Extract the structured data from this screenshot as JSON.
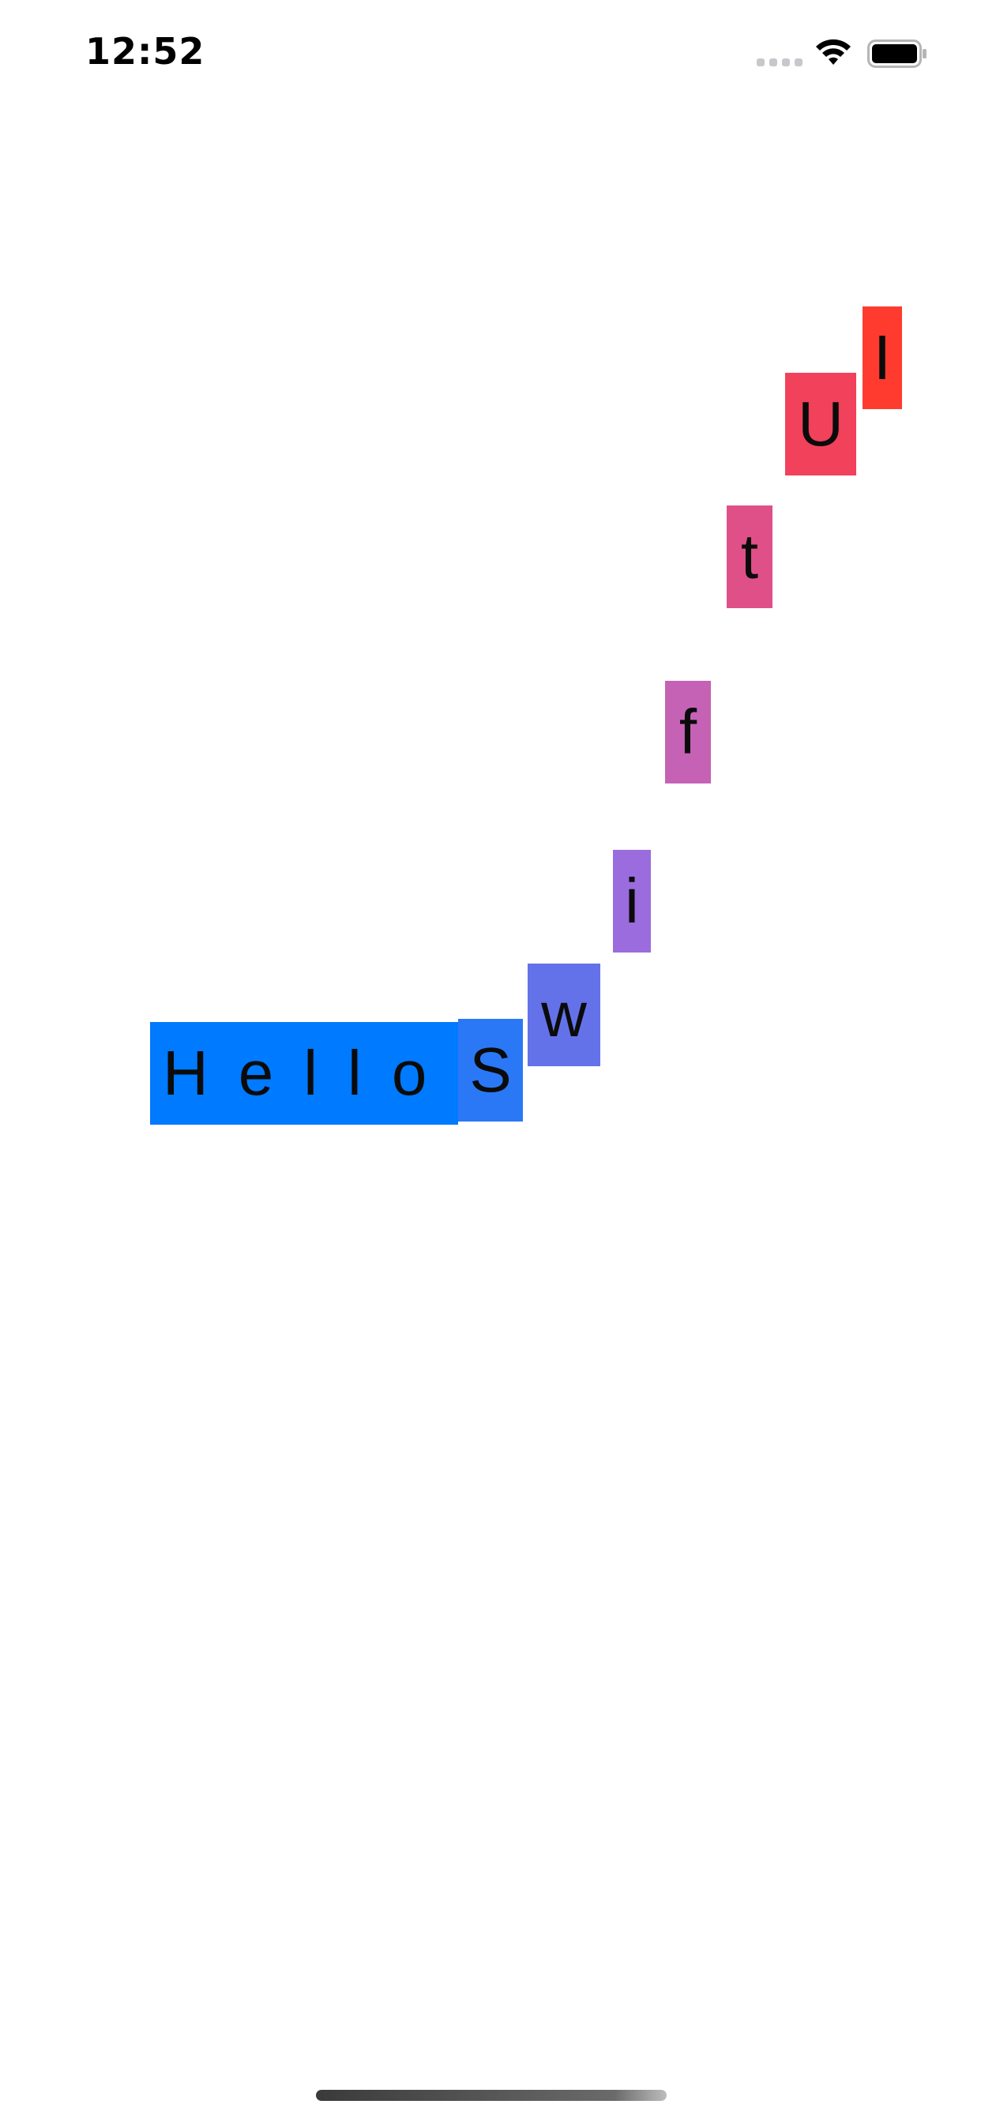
{
  "status_bar": {
    "time": "12:52"
  },
  "colors": {
    "hello": "#007aff",
    "S": "#2a78f6",
    "w": "#6472ea",
    "i": "#9b6cdd",
    "f": "#c562b6",
    "t": "#e05088",
    "U": "#f2415a",
    "I": "#ff3b30"
  },
  "letters": {
    "hello": "Hello",
    "s": "S",
    "w": "w",
    "i": "i",
    "f": "f",
    "t": "t",
    "u": "U",
    "cap_i": "I"
  }
}
